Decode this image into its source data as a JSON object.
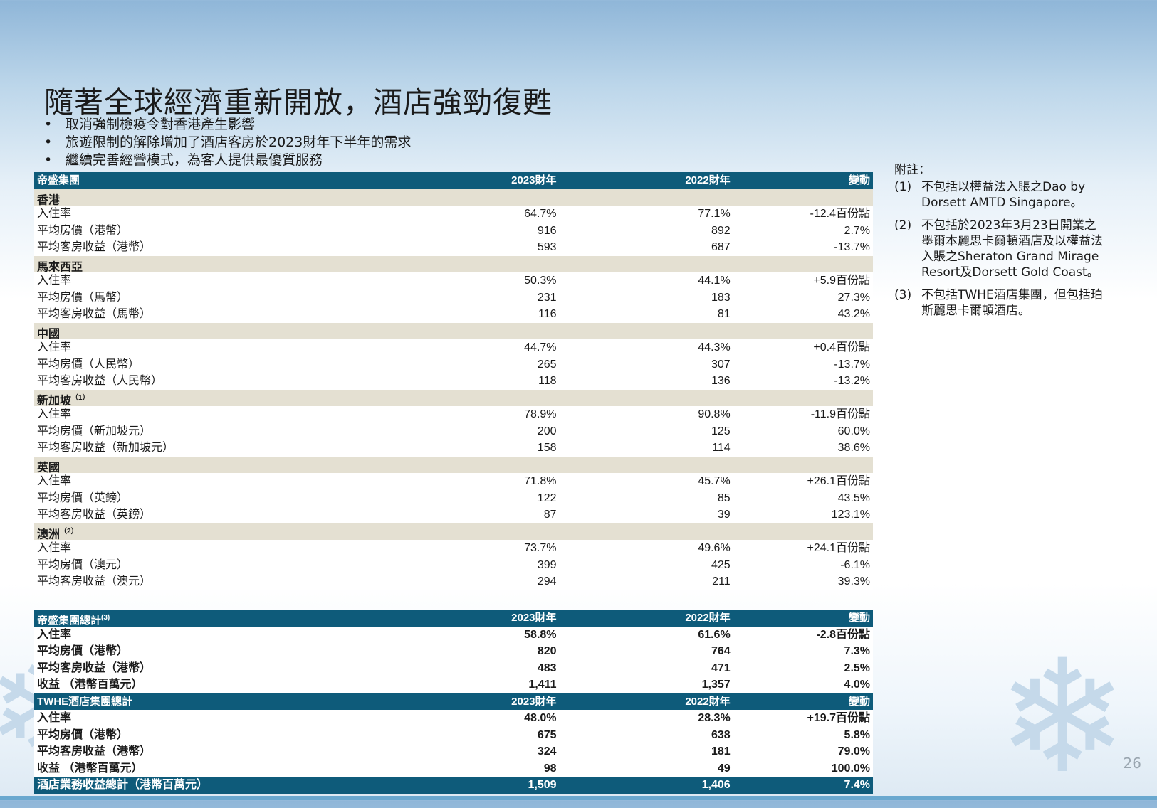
{
  "title": "隨著全球經濟重新開放，酒店強勁復甦",
  "bullets": [
    "取消強制檢疫令對香港產生影響",
    "旅遊限制的解除增加了酒店客房於2023財年下半年的需求",
    "繼續完善經營模式，為客人提供最優質服務"
  ],
  "table1": {
    "header": {
      "label": "帝盛集團",
      "fy23": "2023財年",
      "fy22": "2022財年",
      "change": "變動"
    },
    "regions": [
      {
        "name": "香港",
        "sup": "",
        "rows": [
          {
            "label": "入住率",
            "fy23": "64.7%",
            "fy22": "77.1%",
            "change": "-12.4百份點"
          },
          {
            "label": "平均房價（港幣）",
            "fy23": "916",
            "fy22": "892",
            "change": "2.7%"
          },
          {
            "label": "平均客房收益（港幣）",
            "fy23": "593",
            "fy22": "687",
            "change": "-13.7%"
          }
        ]
      },
      {
        "name": "馬來西亞",
        "sup": "",
        "rows": [
          {
            "label": "入住率",
            "fy23": "50.3%",
            "fy22": "44.1%",
            "change": "+5.9百份點"
          },
          {
            "label": "平均房價（馬幣）",
            "fy23": "231",
            "fy22": "183",
            "change": "27.3%"
          },
          {
            "label": "平均客房收益（馬幣）",
            "fy23": "116",
            "fy22": "81",
            "change": "43.2%"
          }
        ]
      },
      {
        "name": "中國",
        "sup": "",
        "rows": [
          {
            "label": "入住率",
            "fy23": "44.7%",
            "fy22": "44.3%",
            "change": "+0.4百份點"
          },
          {
            "label": "平均房價（人民幣）",
            "fy23": "265",
            "fy22": "307",
            "change": "-13.7%"
          },
          {
            "label": "平均客房收益（人民幣）",
            "fy23": "118",
            "fy22": "136",
            "change": "-13.2%"
          }
        ]
      },
      {
        "name": "新加坡",
        "sup": "（1）",
        "rows": [
          {
            "label": "入住率",
            "fy23": "78.9%",
            "fy22": "90.8%",
            "change": "-11.9百份點"
          },
          {
            "label": "平均房價（新加坡元）",
            "fy23": "200",
            "fy22": "125",
            "change": "60.0%"
          },
          {
            "label": "平均客房收益（新加坡元）",
            "fy23": "158",
            "fy22": "114",
            "change": "38.6%"
          }
        ]
      },
      {
        "name": "英國",
        "sup": "",
        "rows": [
          {
            "label": "入住率",
            "fy23": "71.8%",
            "fy22": "45.7%",
            "change": "+26.1百份點"
          },
          {
            "label": "平均房價（英鎊）",
            "fy23": "122",
            "fy22": "85",
            "change": "43.5%"
          },
          {
            "label": "平均客房收益（英鎊）",
            "fy23": "87",
            "fy22": "39",
            "change": "123.1%"
          }
        ]
      },
      {
        "name": "澳洲",
        "sup": "（2）",
        "rows": [
          {
            "label": "入住率",
            "fy23": "73.7%",
            "fy22": "49.6%",
            "change": "+24.1百份點"
          },
          {
            "label": "平均房價（澳元）",
            "fy23": "399",
            "fy22": "425",
            "change": "-6.1%"
          },
          {
            "label": "平均客房收益（澳元）",
            "fy23": "294",
            "fy22": "211",
            "change": "39.3%"
          }
        ]
      }
    ]
  },
  "table2": {
    "header": {
      "label": "帝盛集團總計",
      "sup": "(3)",
      "fy23": "2023財年",
      "fy22": "2022財年",
      "change": "變動"
    },
    "rows": [
      {
        "label": "入住率",
        "fy23": "58.8%",
        "fy22": "61.6%",
        "change": "-2.8百份點"
      },
      {
        "label": "平均房價（港幣）",
        "fy23": "820",
        "fy22": "764",
        "change": "7.3%"
      },
      {
        "label": "平均客房收益（港幣）",
        "fy23": "483",
        "fy22": "471",
        "change": "2.5%"
      },
      {
        "label": "收益 （港幣百萬元）",
        "fy23": "1,411",
        "fy22": "1,357",
        "change": "4.0%"
      }
    ],
    "header2": {
      "label": "TWHE酒店集團總計",
      "fy23": "2023財年",
      "fy22": "2022財年",
      "change": "變動"
    },
    "rows2": [
      {
        "label": "入住率",
        "fy23": "48.0%",
        "fy22": "28.3%",
        "change": "+19.7百份點"
      },
      {
        "label": "平均房價（港幣）",
        "fy23": "675",
        "fy22": "638",
        "change": "5.8%"
      },
      {
        "label": "平均客房收益（港幣）",
        "fy23": "324",
        "fy22": "181",
        "change": "79.0%"
      },
      {
        "label": "收益 （港幣百萬元）",
        "fy23": "98",
        "fy22": "49",
        "change": "100.0%"
      }
    ],
    "total": {
      "label": "酒店業務收益總計（港幣百萬元）",
      "fy23": "1,509",
      "fy22": "1,406",
      "change": "7.4%"
    }
  },
  "notes": {
    "header": "附註：",
    "items": [
      {
        "num": "(1)",
        "text": "不包括以權益法入賬之Dao by Dorsett AMTD Singapore。"
      },
      {
        "num": "(2)",
        "text": "不包括於2023年3月23日開業之墨爾本麗思卡爾頓酒店及以權益法入賬之Sheraton Grand Mirage Resort及Dorsett Gold Coast。"
      },
      {
        "num": "(3)",
        "text": "不包括TWHE酒店集團，但包括珀斯麗思卡爾頓酒店。"
      }
    ]
  },
  "page_number": "26"
}
